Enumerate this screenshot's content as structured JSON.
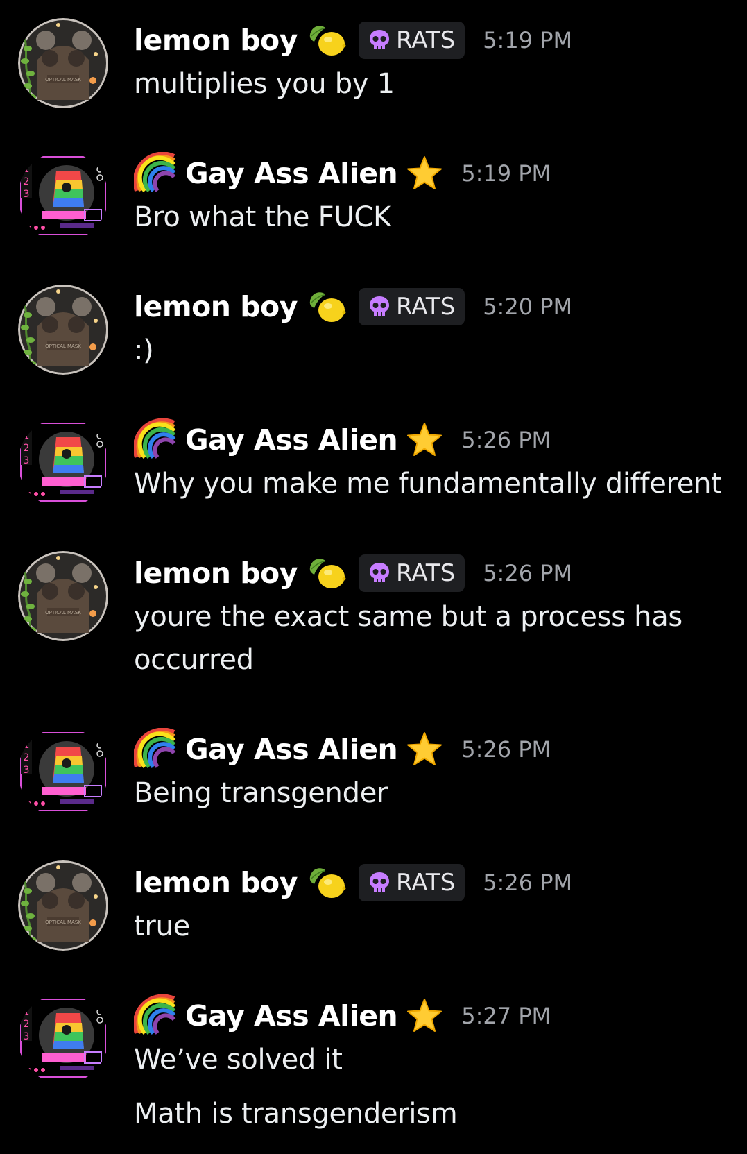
{
  "messages": [
    {
      "author": "lemon boy",
      "badge_emoji": "lemon-icon",
      "role_tag": "RATS",
      "role_icon": "skull-icon",
      "time": "5:19 PM",
      "lines": [
        "multiplies you by 1"
      ]
    },
    {
      "author": "Gay Ass Alien",
      "prefix_emoji": "rainbow-icon",
      "badge_emoji": "star-icon",
      "time": "5:19 PM",
      "lines": [
        "Bro what the FUCK"
      ]
    },
    {
      "author": "lemon boy",
      "badge_emoji": "lemon-icon",
      "role_tag": "RATS",
      "role_icon": "skull-icon",
      "time": "5:20 PM",
      "lines": [
        ":)"
      ]
    },
    {
      "author": "Gay Ass Alien",
      "prefix_emoji": "rainbow-icon",
      "badge_emoji": "star-icon",
      "time": "5:26 PM",
      "lines": [
        "Why you make me fundamentally different"
      ]
    },
    {
      "author": "lemon boy",
      "badge_emoji": "lemon-icon",
      "role_tag": "RATS",
      "role_icon": "skull-icon",
      "time": "5:26 PM",
      "lines": [
        "youre the exact same but a process has occurred"
      ]
    },
    {
      "author": "Gay Ass Alien",
      "prefix_emoji": "rainbow-icon",
      "badge_emoji": "star-icon",
      "time": "5:26 PM",
      "lines": [
        "Being transgender"
      ]
    },
    {
      "author": "lemon boy",
      "badge_emoji": "lemon-icon",
      "role_tag": "RATS",
      "role_icon": "skull-icon",
      "time": "5:26 PM",
      "lines": [
        "true"
      ]
    },
    {
      "author": "Gay Ass Alien",
      "prefix_emoji": "rainbow-icon",
      "badge_emoji": "star-icon",
      "time": "5:27 PM",
      "lines": [
        "We’ve solved it",
        "Math is transgenderism"
      ]
    }
  ],
  "colors": {
    "background": "#000000",
    "username": "#ffffff",
    "message_text": "#eceff1",
    "timestamp": "#a2a5ab",
    "role_tag_bg": "#1e1f22",
    "skull": "#c77dff"
  }
}
